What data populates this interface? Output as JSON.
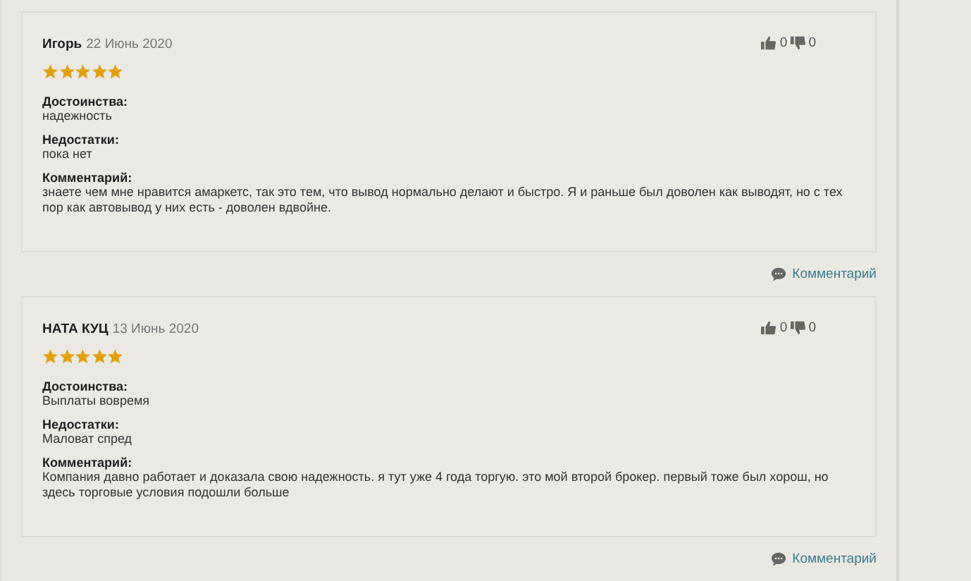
{
  "reviews": [
    {
      "author": "Игорь",
      "date": "22 Июнь 2020",
      "stars": 5,
      "likes": "0",
      "dislikes": "0",
      "sections": [
        {
          "label": "Достоинства:",
          "text": "надежность"
        },
        {
          "label": "Недостатки:",
          "text": "пока нет"
        },
        {
          "label": "Комментарий:",
          "text": "знаете чем мне нравится амаркетс, так это тем, что вывод нормально делают и быстро. Я и раньше был доволен как выводят, но с тех пор как автовывод у них есть - доволен вдвойне."
        }
      ],
      "comment_link": "Комментарий"
    },
    {
      "author": "НАТА КУЦ",
      "date": "13 Июнь 2020",
      "stars": 5,
      "likes": "0",
      "dislikes": "0",
      "sections": [
        {
          "label": "Достоинства:",
          "text": "Выплаты вовремя"
        },
        {
          "label": "Недостатки:",
          "text": "Маловат спред"
        },
        {
          "label": "Комментарий:",
          "text": "Компания давно работает и доказала свою надежность. я тут уже 4 года торгую. это мой второй брокер. первый тоже был хорош, но здесь торговые условия подошли больше"
        }
      ],
      "comment_link": "Комментарий"
    }
  ]
}
